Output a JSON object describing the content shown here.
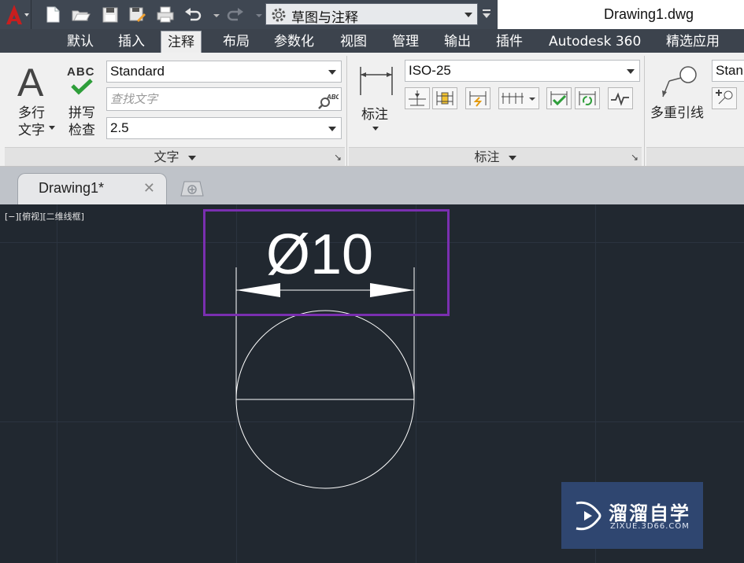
{
  "titlebar": {
    "workspace": "草图与注释",
    "document_title": "Drawing1.dwg"
  },
  "ribbon_tabs": [
    "默认",
    "插入",
    "注释",
    "布局",
    "参数化",
    "视图",
    "管理",
    "输出",
    "插件",
    "Autodesk 360",
    "精选应用"
  ],
  "active_tab": "注释",
  "text_panel": {
    "multiline_text_line1": "多行",
    "multiline_text_line2": "文字",
    "spell_check_line1": "拼写",
    "spell_check_line2": "检查",
    "spell_icon_text": "ABC",
    "big_icon_letter": "A",
    "style_value": "Standard",
    "find_placeholder": "查找文字",
    "height_value": "2.5",
    "footer": "文字"
  },
  "dim_panel": {
    "dimension_label": "标注",
    "style_value": "ISO-25",
    "footer": "标注"
  },
  "leader_panel": {
    "multileader_label": "多重引线",
    "style_value": "Stan"
  },
  "file_tabs": {
    "active_name": "Drawing1*",
    "close_glyph": "✕"
  },
  "viewport": {
    "label": "[−][俯视][二维线框]",
    "dimension_text": "Ø10"
  },
  "watermark": {
    "title": "溜溜自学",
    "subtitle": "ZIXUE.3D66.COM"
  },
  "colors": {
    "canvas_bg": "#212830",
    "highlight_border": "#7a2fb0",
    "ribbon_dark": "#3c434d",
    "app_red": "#c81e1e"
  }
}
